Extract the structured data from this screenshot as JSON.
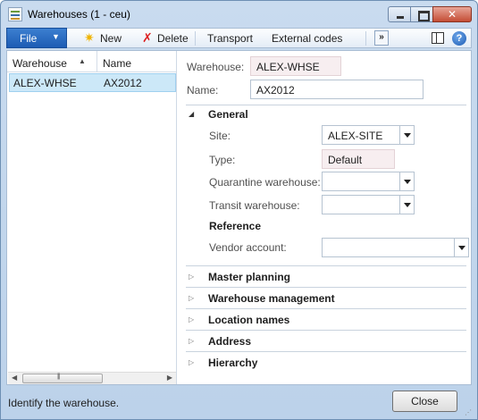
{
  "window": {
    "title": "Warehouses (1 - ceu)"
  },
  "toolbar": {
    "file_label": "File",
    "new_label": "New",
    "delete_label": "Delete",
    "transport_label": "Transport",
    "external_codes_label": "External codes",
    "more_label": "»",
    "help_label": "?"
  },
  "grid": {
    "columns": [
      "Warehouse",
      "Name"
    ],
    "rows": [
      {
        "warehouse": "ALEX-WHSE",
        "name": "AX2012"
      }
    ],
    "scroll_grip": "III"
  },
  "header_fields": {
    "warehouse_label": "Warehouse:",
    "warehouse_value": "ALEX-WHSE",
    "name_label": "Name:",
    "name_value": "AX2012"
  },
  "general": {
    "title": "General",
    "site_label": "Site:",
    "site_value": "ALEX-SITE",
    "type_label": "Type:",
    "type_value": "Default",
    "quarantine_label": "Quarantine warehouse:",
    "quarantine_value": "",
    "transit_label": "Transit warehouse:",
    "transit_value": "",
    "reference_title": "Reference",
    "vendor_label": "Vendor account:",
    "vendor_value": ""
  },
  "fasttabs": [
    {
      "label": "Master planning"
    },
    {
      "label": "Warehouse management"
    },
    {
      "label": "Location names"
    },
    {
      "label": "Address"
    },
    {
      "label": "Hierarchy"
    }
  ],
  "status": {
    "text": "Identify the warehouse.",
    "close_label": "Close"
  }
}
